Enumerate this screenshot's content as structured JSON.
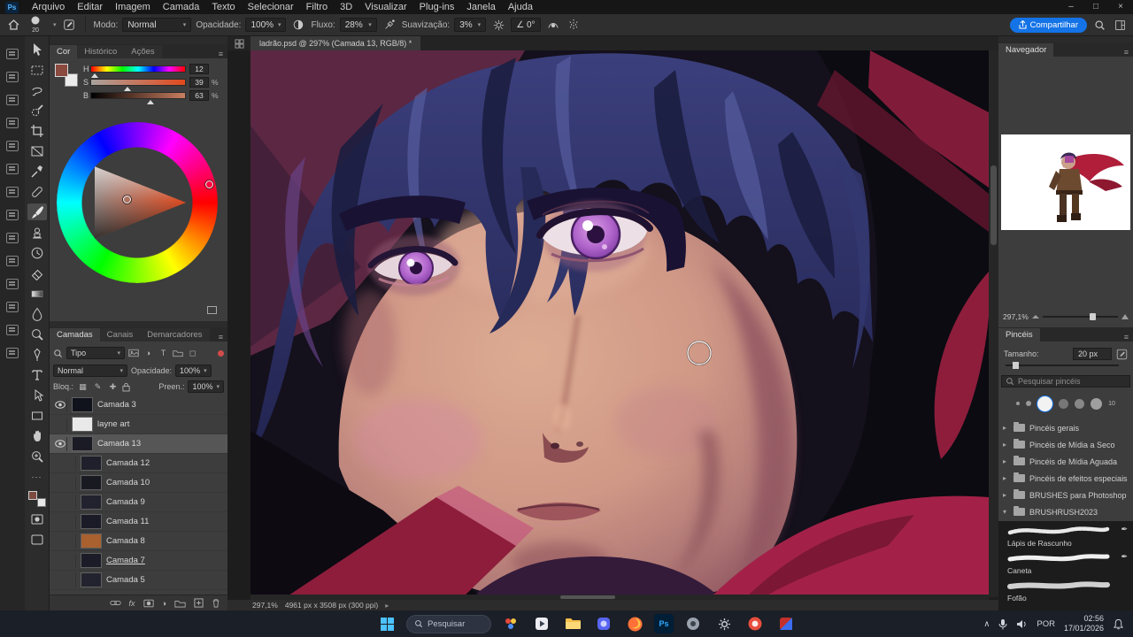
{
  "window": {
    "minimize": "–",
    "maximize": "□",
    "close": "×",
    "app_initials": "Ps"
  },
  "menu_bar": {
    "items": [
      "Arquivo",
      "Editar",
      "Imagem",
      "Camada",
      "Texto",
      "Selecionar",
      "Filtro",
      "3D",
      "Visualizar",
      "Plug-ins",
      "Janela",
      "Ajuda"
    ]
  },
  "options_bar": {
    "brush_size": "20",
    "modo_label": "Modo:",
    "modo_value": "Normal",
    "opacidade_label": "Opacidade:",
    "opacidade_value": "100%",
    "fluxo_label": "Fluxo:",
    "fluxo_value": "28%",
    "suavizacao_label": "Suavização:",
    "suavizacao_value": "3%",
    "angle_value": "0°",
    "share_label": "Compartilhar"
  },
  "document_tab": {
    "title": "ladrão.psd @ 297% (Camada 13, RGB/8) *"
  },
  "color_panel": {
    "tabs": [
      "Cor",
      "Histórico",
      "Ações"
    ],
    "h_label": "H",
    "h_value": "12",
    "s_label": "S",
    "s_value": "39",
    "s_unit": "%",
    "b_label": "B",
    "b_value": "63",
    "b_unit": "%"
  },
  "layers_panel": {
    "tabs": [
      "Camadas",
      "Canais",
      "Demarcadores"
    ],
    "filter_label": "Tipo",
    "blend_mode": "Normal",
    "opacity_label": "Opacidade:",
    "opacity_value": "100%",
    "lock_label": "Bloq.:",
    "fill_label": "Preen.:",
    "fill_value": "100%",
    "layers": [
      {
        "name": "Camada 3",
        "visible": true,
        "selected": false,
        "thumb": "#10121c"
      },
      {
        "name": "layne art",
        "visible": false,
        "selected": false,
        "thumb": "#e9e9e9"
      },
      {
        "name": "Camada 13",
        "visible": true,
        "selected": true,
        "thumb": "#1b1b26"
      },
      {
        "name": "Camada 12",
        "visible": false,
        "selected": false,
        "thumb": "#20202c"
      },
      {
        "name": "Camada 10",
        "visible": false,
        "selected": false,
        "thumb": "#191922"
      },
      {
        "name": "Camada 9",
        "visible": false,
        "selected": false,
        "thumb": "#22222e"
      },
      {
        "name": "Camada 11",
        "visible": false,
        "selected": false,
        "thumb": "#1b1b28"
      },
      {
        "name": "Camada 8",
        "visible": false,
        "selected": false,
        "thumb": "#a8612f"
      },
      {
        "name": "Camada 7",
        "visible": false,
        "selected": false,
        "thumb": "#1c1c28",
        "underline": true
      },
      {
        "name": "Camada 5",
        "visible": false,
        "selected": false,
        "thumb": "#23232f"
      }
    ]
  },
  "status_bar": {
    "zoom": "297,1%",
    "doc_info": "4961 px x 3508 px (300 ppi)"
  },
  "navigator_panel": {
    "title": "Navegador",
    "zoom": "297,1%"
  },
  "brushes_panel": {
    "title": "Pincéis",
    "size_label": "Tamanho:",
    "size_value": "20 px",
    "search_placeholder": "Pesquisar pincéis",
    "dot_label": "10",
    "folders": [
      "Pincéis gerais",
      "Pincéis de Mídia a Seco",
      "Pincéis de Mídia Aguada",
      "Pincéis de efeitos especiais",
      "BRUSHES para Photoshop",
      "BRUSHRUSH2023"
    ],
    "brushes": [
      "Lápis de Rascunho",
      "Caneta",
      "Fofão"
    ]
  },
  "taskbar": {
    "search_placeholder": "Pesquisar",
    "language": "POR",
    "time": "02:56",
    "date": "17/01/2026"
  },
  "icons": {
    "chevron_down": "▾",
    "chevron_right": "▸",
    "chevron_up": "∧",
    "pen_nib": "✒",
    "adjustment_half": "◑",
    "fx": "fx",
    "ellipsis": "···",
    "lock_checker": "▦",
    "lock_pencil": "✎",
    "lock_cross": "✚",
    "angle": "∠"
  }
}
